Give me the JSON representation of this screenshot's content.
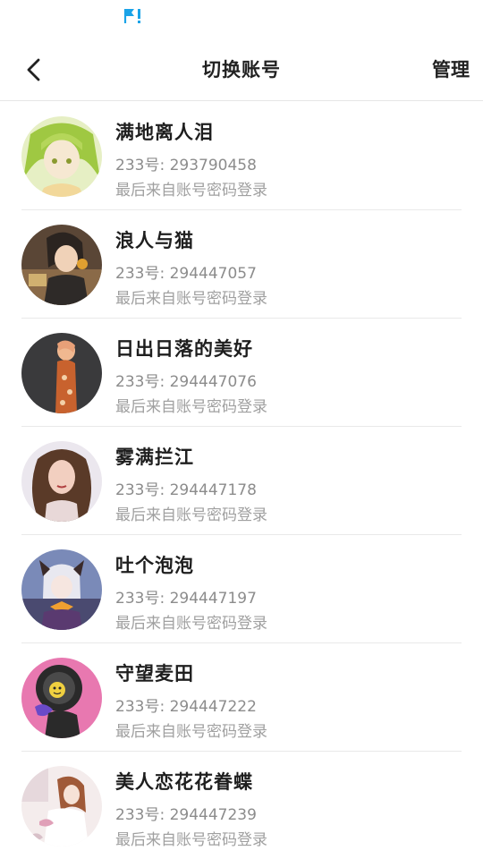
{
  "nav": {
    "title": "切换账号",
    "manage_label": "管理"
  },
  "accounts": [
    {
      "name": "满地离人泪",
      "id": "233号: 293790458",
      "login": "最后来自账号密码登录",
      "avatar_colors": [
        "#d8e7a8",
        "#9fc842",
        "#f3e6c8"
      ]
    },
    {
      "name": "浪人与猫",
      "id": "233号: 294447057",
      "login": "最后来自账号密码登录",
      "avatar_colors": [
        "#4a3a30",
        "#2b2420",
        "#e0a030"
      ]
    },
    {
      "name": "日出日落的美好",
      "id": "233号: 294447076",
      "login": "最后来自账号密码登录",
      "avatar_colors": [
        "#3a3a3c",
        "#c8622e",
        "#f0b890"
      ]
    },
    {
      "name": "雾满拦江",
      "id": "233号: 294447178",
      "login": "最后来自账号密码登录",
      "avatar_colors": [
        "#e8e4ec",
        "#5a3a28",
        "#f0c8b8"
      ]
    },
    {
      "name": "吐个泡泡",
      "id": "233号: 294447197",
      "login": "最后来自账号密码登录",
      "avatar_colors": [
        "#7a8ab8",
        "#e8e8f0",
        "#f0a030"
      ]
    },
    {
      "name": "守望麦田",
      "id": "233号: 294447222",
      "login": "最后来自账号密码登录",
      "avatar_colors": [
        "#e878b0",
        "#2a2a2a",
        "#f0d040"
      ]
    },
    {
      "name": "美人恋花花眷蝶",
      "id": "233号: 294447239",
      "login": "最后来自账号密码登录",
      "avatar_colors": [
        "#f4ecec",
        "#a05a38",
        "#d8c0c8"
      ]
    }
  ],
  "status_bar": {
    "accent_color": "#1aa3e8"
  }
}
